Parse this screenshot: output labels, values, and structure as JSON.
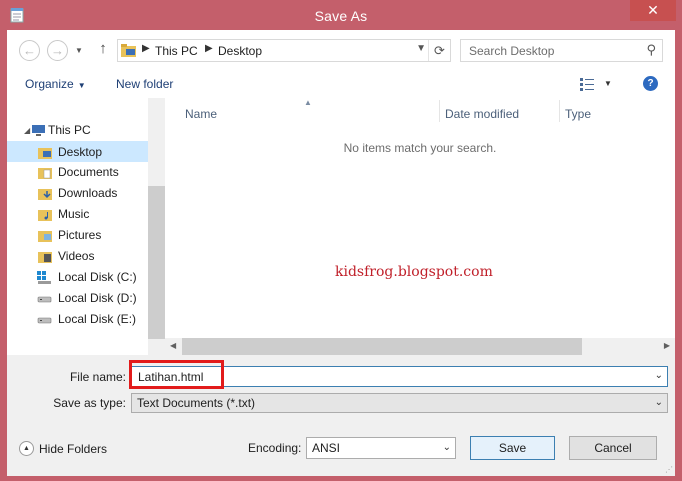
{
  "window": {
    "title": "Save As",
    "close_glyph": "✕"
  },
  "navbar": {
    "back_icon": "back-arrow-icon",
    "forward_icon": "forward-arrow-icon",
    "up_icon": "up-arrow-icon",
    "breadcrumb": [
      "This PC",
      "Desktop"
    ],
    "search_placeholder": "Search Desktop"
  },
  "toolbar": {
    "organize_label": "Organize",
    "new_folder_label": "New folder"
  },
  "nav_tree": {
    "items": [
      {
        "label": "This PC",
        "icon": "computer-icon"
      },
      {
        "label": "Desktop",
        "icon": "folder-desktop-icon",
        "selected": true
      },
      {
        "label": "Documents",
        "icon": "folder-documents-icon"
      },
      {
        "label": "Downloads",
        "icon": "folder-downloads-icon"
      },
      {
        "label": "Music",
        "icon": "folder-music-icon"
      },
      {
        "label": "Pictures",
        "icon": "folder-pictures-icon"
      },
      {
        "label": "Videos",
        "icon": "folder-videos-icon"
      },
      {
        "label": "Local Disk (C:)",
        "icon": "windows-drive-icon"
      },
      {
        "label": "Local Disk (D:)",
        "icon": "drive-icon"
      },
      {
        "label": "Local Disk (E:)",
        "icon": "drive-icon"
      }
    ]
  },
  "file_list": {
    "columns": [
      "Name",
      "Date modified",
      "Type"
    ],
    "empty_message": "No items match your search.",
    "watermark": "kidsfrog.blogspot.com"
  },
  "save_panel": {
    "file_name_label": "File name:",
    "file_name_value": "Latihan.html",
    "save_as_type_label": "Save as type:",
    "save_as_type_value": "Text Documents (*.txt)",
    "hide_folders_label": "Hide Folders",
    "encoding_label": "Encoding:",
    "encoding_value": "ANSI",
    "save_label": "Save",
    "cancel_label": "Cancel"
  },
  "colors": {
    "frame": "#c45f6b",
    "selection": "#cce8ff",
    "highlight_box": "#e21b1b",
    "watermark": "#c0202a"
  }
}
